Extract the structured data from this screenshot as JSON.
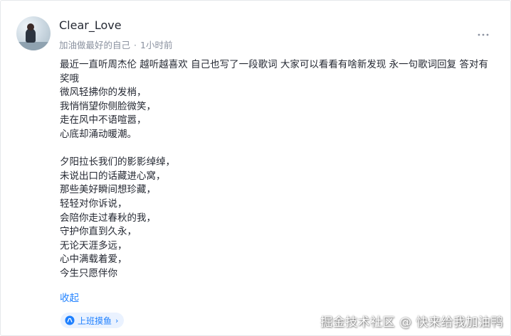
{
  "post": {
    "username": "Clear_Love",
    "signature": "加油做最好的自己",
    "separator": "·",
    "time": "1小时前",
    "more_icon": "more-dots-icon",
    "intro": "最近一直听周杰伦 越听越喜欢 自己也写了一段歌词 大家可以看看有啥新发现 永一句歌词回复 答对有奖哦",
    "lyrics_verse1": [
      "微风轻拂你的发梢，",
      "我悄悄望你侧脸微笑，",
      "走在风中不语喧嚣，",
      "心底却涌动暖潮。"
    ],
    "lyrics_verse2": [
      "夕阳拉长我们的影影绰绰，",
      "未说出口的话藏进心窝，",
      "那些美好瞬间想珍藏，",
      "轻轻对你诉说，",
      "会陪你走过春秋的我，",
      "守护你直到久永，",
      "无论天涯多远，",
      "心中满载着爱，",
      "今生只愿伴你"
    ],
    "collapse_label": "收起",
    "topic_label": "上班摸鱼",
    "topic_chevron": "›"
  },
  "watermark": "掘金技术社区 @ 快来给我加油鸭",
  "colors": {
    "link": "#1e80ff",
    "text": "#252933",
    "muted": "#8a919f",
    "topic_bg": "#eaf2ff"
  }
}
